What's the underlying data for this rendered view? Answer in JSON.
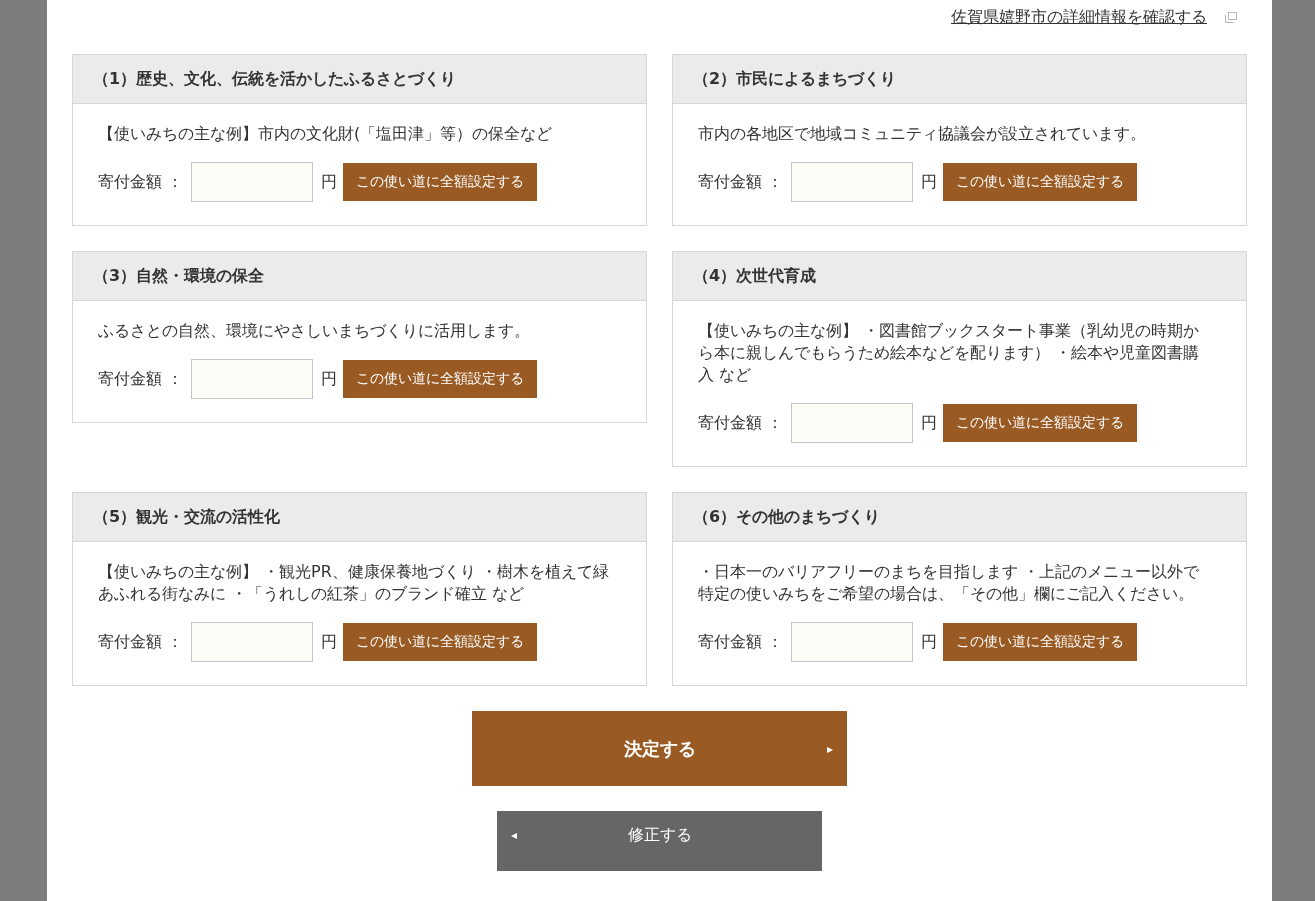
{
  "detail_link": {
    "text": "佐賀県嬉野市の詳細情報を確認する"
  },
  "cards": [
    {
      "title": "（1）歴史、文化、伝統を活かしたふるさとづくり",
      "description": "【使いみちの主な例】市内の文化財(「塩田津」等）の保全など",
      "amount_label": "寄付金額 ：",
      "unit": "円",
      "set_all_button": "この使い道に全額設定する"
    },
    {
      "title": "（2）市民によるまちづくり",
      "description": "市内の各地区で地域コミュニティ協議会が設立されています。",
      "amount_label": "寄付金額 ：",
      "unit": "円",
      "set_all_button": "この使い道に全額設定する"
    },
    {
      "title": "（3）自然・環境の保全",
      "description": "ふるさとの自然、環境にやさしいまちづくりに活用します。",
      "amount_label": "寄付金額 ：",
      "unit": "円",
      "set_all_button": "この使い道に全額設定する"
    },
    {
      "title": "（4）次世代育成",
      "description": "【使いみちの主な例】 ・図書館ブックスタート事業（乳幼児の時期から本に親しんでもらうため絵本などを配ります） ・絵本や児童図書購入 など",
      "amount_label": "寄付金額 ：",
      "unit": "円",
      "set_all_button": "この使い道に全額設定する"
    },
    {
      "title": "（5）観光・交流の活性化",
      "description": "【使いみちの主な例】 ・観光PR、健康保養地づくり ・樹木を植えて緑あふれる街なみに ・「うれしの紅茶」のブランド確立 など",
      "amount_label": "寄付金額 ：",
      "unit": "円",
      "set_all_button": "この使い道に全額設定する"
    },
    {
      "title": "（6）その他のまちづくり",
      "description": "・日本一のバリアフリーのまちを目指します ・上記のメニュー以外で特定の使いみちをご希望の場合は、「その他」欄にご記入ください。",
      "amount_label": "寄付金額 ：",
      "unit": "円",
      "set_all_button": "この使い道に全額設定する"
    }
  ],
  "confirm_button": {
    "label": "決定する",
    "arrow": "▸"
  },
  "back_button": {
    "label": "修正する",
    "arrow": "◂"
  }
}
